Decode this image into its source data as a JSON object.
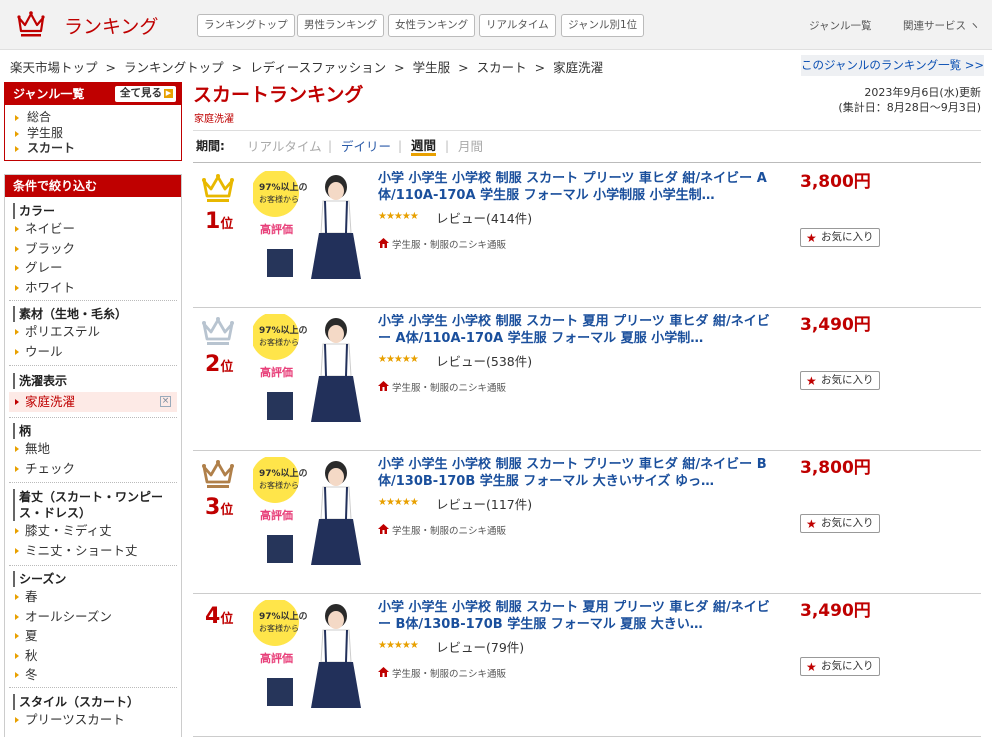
{
  "header": {
    "logo_text": "ランキング",
    "nav": [
      "ランキングトップ",
      "男性ランキング",
      "女性ランキング",
      "リアルタイム",
      "ジャンル別1位"
    ],
    "genre_link": "ジャンル一覧",
    "related_services": "関連サービス"
  },
  "breadcrumb": [
    "楽天市場トップ",
    "ランキングトップ",
    "レディースファッション",
    "学生服",
    "スカート",
    "家庭洗濯"
  ],
  "genre_ranking_list_link": "このジャンルのランキング一覧 >>",
  "sidebar": {
    "genre_title": "ジャンル一覧",
    "view_all": "全て見る",
    "genre_items": [
      "総合",
      "学生服",
      "スカート"
    ],
    "filter_title": "条件で絞り込む",
    "filter_sections": [
      {
        "title": "カラー",
        "items": [
          "ネイビー",
          "ブラック",
          "グレー",
          "ホワイト"
        ]
      },
      {
        "title": "素材（生地・毛糸）",
        "items": [
          "ポリエステル",
          "ウール"
        ]
      },
      {
        "title": "洗濯表示",
        "items": [
          "家庭洗濯"
        ]
      },
      {
        "title": "柄",
        "items": [
          "無地",
          "チェック"
        ]
      },
      {
        "title": "着丈（スカート・ワンピース・ドレス）",
        "items": [
          "膝丈・ミディ丈",
          "ミニ丈・ショート丈"
        ]
      },
      {
        "title": "シーズン",
        "items": [
          "春",
          "オールシーズン",
          "夏",
          "秋",
          "冬"
        ]
      },
      {
        "title": "スタイル（スカート）",
        "items": [
          "プリーツスカート"
        ]
      }
    ]
  },
  "main": {
    "title": "スカートランキング",
    "subtitle": "家庭洗濯",
    "updated": "2023年9月6日(水)更新",
    "period_range": "(集計日：8月28日～9月3日)",
    "period_label": "期間:",
    "periods": [
      "リアルタイム",
      "デイリー",
      "週間",
      "月間"
    ],
    "thumb_text": {
      "a": "97%以上の",
      "b": "お客様から",
      "c": "高評価"
    },
    "products": [
      {
        "rank": "1",
        "rank_suffix": "位",
        "title": "小学 小学生 小学校 制服 スカート プリーツ 車ヒダ 紺/ネイビー A体/110A-170A 学生服 フォーマル 小学制服 小学生制…",
        "stars": "★★★★★",
        "review": "レビュー(414件)",
        "shop": "学生服・制服のニシキ通販",
        "price": "3,800円",
        "fav": "お気に入り",
        "crown_color": "#e8b800"
      },
      {
        "rank": "2",
        "rank_suffix": "位",
        "title": "小学 小学生 小学校 制服 スカート 夏用 プリーツ 車ヒダ 紺/ネイビー A体/110A-170A 学生服 フォーマル 夏服 小学制…",
        "stars": "★★★★★",
        "review": "レビュー(538件)",
        "shop": "学生服・制服のニシキ通販",
        "price": "3,490円",
        "fav": "お気に入り",
        "crown_color": "#b8c4d0"
      },
      {
        "rank": "3",
        "rank_suffix": "位",
        "title": "小学 小学生 小学校 制服 スカート プリーツ 車ヒダ 紺/ネイビー B体/130B-170B 学生服 フォーマル 大きいサイズ ゆっ…",
        "stars": "★★★★★",
        "review": "レビュー(117件)",
        "shop": "学生服・制服のニシキ通販",
        "price": "3,800円",
        "fav": "お気に入り",
        "crown_color": "#b0804a"
      },
      {
        "rank": "4",
        "rank_suffix": "位",
        "title": "小学 小学生 小学校 制服 スカート 夏用 プリーツ 車ヒダ 紺/ネイビー B体/130B-170B 学生服 フォーマル 夏服 大きい…",
        "stars": "★★★★★",
        "review": "レビュー(79件)",
        "shop": "学生服・制服のニシキ通販",
        "price": "3,490円",
        "fav": "お気に入り",
        "crown_color": ""
      }
    ]
  },
  "colors": {
    "brand": "#bf0000",
    "link": "#1a4f9c",
    "accent": "#e8a000"
  }
}
